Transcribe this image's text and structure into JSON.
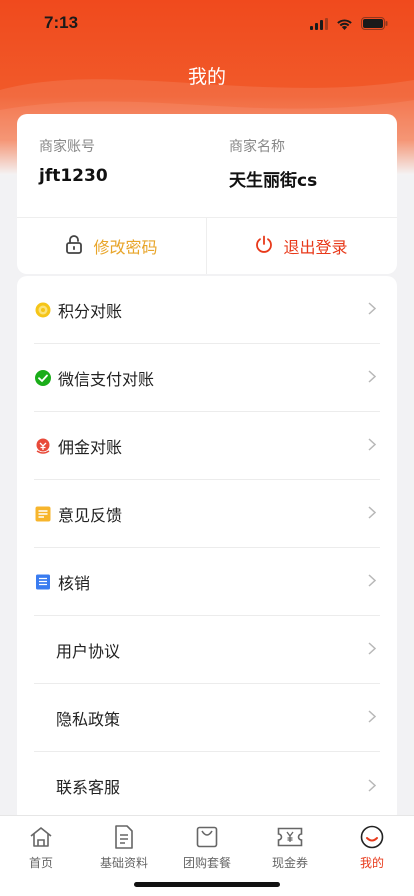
{
  "status_bar": {
    "time": "7:13"
  },
  "page": {
    "title": "我的"
  },
  "account": {
    "account_label": "商家账号",
    "account_value": "jft1230",
    "name_label": "商家名称",
    "name_value": "天生丽街cs",
    "change_password": "修改密码",
    "logout": "退出登录"
  },
  "menu": {
    "items": [
      {
        "label": "积分对账",
        "icon": "points-coin-icon"
      },
      {
        "label": "微信支付对账",
        "icon": "wechat-pay-icon"
      },
      {
        "label": "佣金对账",
        "icon": "commission-icon"
      },
      {
        "label": "意见反馈",
        "icon": "feedback-icon"
      },
      {
        "label": "核销",
        "icon": "verify-receipt-icon"
      },
      {
        "label": "用户协议",
        "icon": ""
      },
      {
        "label": "隐私政策",
        "icon": ""
      },
      {
        "label": "联系客服",
        "icon": ""
      }
    ]
  },
  "tabs": [
    {
      "label": "首页",
      "icon": "home-icon"
    },
    {
      "label": "基础资料",
      "icon": "document-icon"
    },
    {
      "label": "团购套餐",
      "icon": "shopping-bag-icon"
    },
    {
      "label": "现金券",
      "icon": "coupon-icon"
    },
    {
      "label": "我的",
      "icon": "profile-icon",
      "active": true
    }
  ],
  "colors": {
    "brand": "#f04a1d",
    "password_text": "#e8a52a",
    "logout_text": "#e8391a",
    "active_tab": "#e8391a"
  }
}
